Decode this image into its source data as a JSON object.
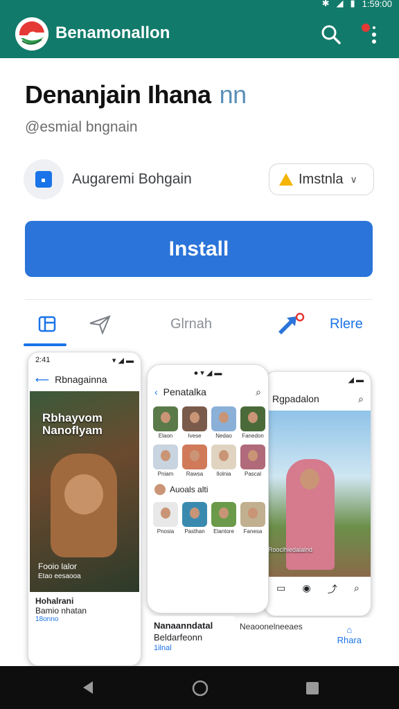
{
  "status_bar": {
    "time": "1:59:00"
  },
  "app_bar": {
    "title": "Benamonallon",
    "search_icon": "search-icon",
    "menu_icon": "more-vert-icon"
  },
  "app": {
    "title": "Denanjain Ihana",
    "title_suffix": "nn",
    "subtitle": "@esmial bngnain",
    "developer": "Augaremi Bohgain",
    "dropdown_label": "Imstnla"
  },
  "install_label": "Install",
  "tabs": [
    {
      "label": "",
      "icon": "grid-icon"
    },
    {
      "label": "",
      "icon": "send-icon"
    },
    {
      "label": "Glrnah"
    },
    {
      "label": "",
      "icon": "share-icon"
    },
    {
      "label": "Rlere"
    }
  ],
  "screens": {
    "left": {
      "time": "2:41",
      "header": "Rbnagainna",
      "banner_text": "Rbhayvom Nanoflyam",
      "footer_a": "Fooio lalor",
      "footer_b": "Etao eesaooa",
      "caption_title": "Hohalrani",
      "caption_sub": "Bamio nhatan",
      "caption_meta": "18onno"
    },
    "middle": {
      "header": "Penatalka",
      "row_labels": [
        "Elaon",
        "Ivese",
        "Nedao",
        "Fanedon"
      ],
      "row2_labels": [
        "Pniam",
        "Rawsa",
        "Ilolnia",
        "Pascal"
      ],
      "section_title": "Auoals alti",
      "row3_labels": [
        "Pnosia",
        "Pasthan",
        "Elantore",
        "Fanesa"
      ],
      "caption_title": "Nanaanndatal",
      "caption_sub": "Beldarfeonn",
      "caption_meta": "1ilnal"
    },
    "right": {
      "header": "Rgpadalon",
      "overlay_text": "Rooclhiedalalnd",
      "caption_title": "Neaoonelneeaes",
      "caption_link": "Rhara"
    }
  },
  "colors": {
    "primary": "#127a6a",
    "accent": "#2b74d9",
    "warn": "#f4b400"
  }
}
